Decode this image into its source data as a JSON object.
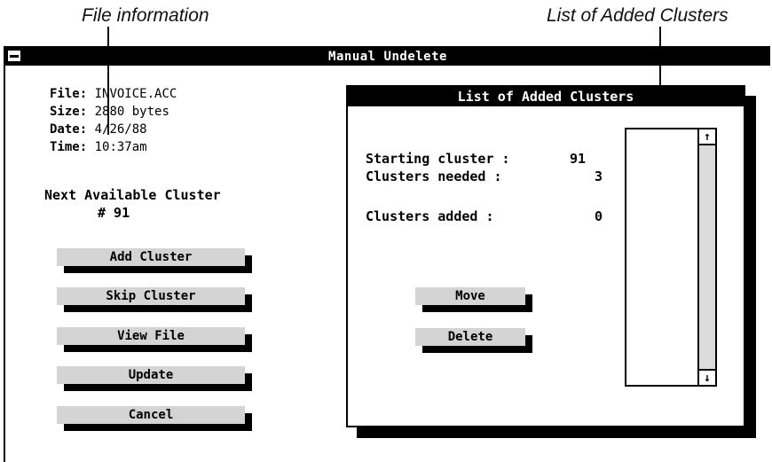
{
  "callouts": {
    "file_information": "File information",
    "list_of_added_clusters": "List of Added Clusters"
  },
  "window": {
    "title": "Manual Undelete"
  },
  "file_info": {
    "file_label": "File:",
    "file_value": "INVOICE.ACC",
    "size_label": "Size:",
    "size_value": "2880 bytes",
    "date_label": "Date:",
    "date_value": "4/26/88",
    "time_label": "Time:",
    "time_value": "10:37am"
  },
  "next_cluster": {
    "label": "Next Available Cluster",
    "value": "#   91"
  },
  "buttons": {
    "add_cluster": "Add Cluster",
    "skip_cluster": "Skip Cluster",
    "view_file": "View File",
    "update": "Update",
    "cancel": "Cancel"
  },
  "dialog": {
    "title": "List of Added Clusters",
    "starting_cluster_label": "Starting cluster :",
    "starting_cluster_value": "91",
    "clusters_needed_label": "Clusters needed  :",
    "clusters_needed_value": "3",
    "clusters_added_label": "Clusters added   :",
    "clusters_added_value": "0",
    "move_button": "Move",
    "delete_button": "Delete"
  },
  "icons": {
    "scroll_up": "↑",
    "scroll_down": "↓"
  }
}
